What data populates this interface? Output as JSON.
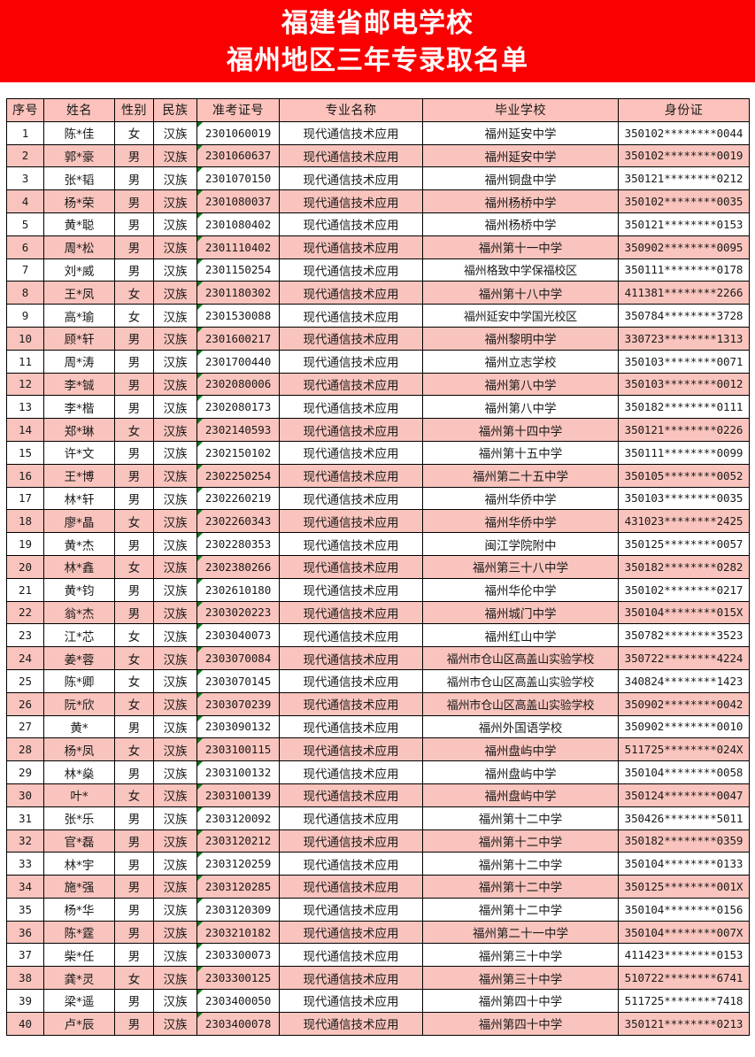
{
  "banner": {
    "line1": "福建省邮电学校",
    "line2": "福州地区三年专录取名单",
    "background_color": "#fb0000",
    "text_color": "#ffffff"
  },
  "colors": {
    "header_fill": "#fcc2bb",
    "row_alt_fill": "#f9c4bd",
    "row_fill": "#ffffff",
    "grid_line": "#000000",
    "text_flag_marker": "#0e7a18"
  },
  "table": {
    "headers": [
      "序号",
      "姓名",
      "性别",
      "民族",
      "准考证号",
      "专业名称",
      "毕业学校",
      "身份证"
    ],
    "rows": [
      {
        "seq": "1",
        "name": "陈*佳",
        "sex": "女",
        "eth": "汉族",
        "exam": "2301060019",
        "major": "现代通信技术应用",
        "school": "福州延安中学",
        "id": "350102********0044"
      },
      {
        "seq": "2",
        "name": "郭*豪",
        "sex": "男",
        "eth": "汉族",
        "exam": "2301060637",
        "major": "现代通信技术应用",
        "school": "福州延安中学",
        "id": "350102********0019"
      },
      {
        "seq": "3",
        "name": "张*韬",
        "sex": "男",
        "eth": "汉族",
        "exam": "2301070150",
        "major": "现代通信技术应用",
        "school": "福州铜盘中学",
        "id": "350121********0212"
      },
      {
        "seq": "4",
        "name": "杨*荣",
        "sex": "男",
        "eth": "汉族",
        "exam": "2301080037",
        "major": "现代通信技术应用",
        "school": "福州杨桥中学",
        "id": "350102********0035"
      },
      {
        "seq": "5",
        "name": "黄*聪",
        "sex": "男",
        "eth": "汉族",
        "exam": "2301080402",
        "major": "现代通信技术应用",
        "school": "福州杨桥中学",
        "id": "350121********0153"
      },
      {
        "seq": "6",
        "name": "周*松",
        "sex": "男",
        "eth": "汉族",
        "exam": "2301110402",
        "major": "现代通信技术应用",
        "school": "福州第十一中学",
        "id": "350902********0095"
      },
      {
        "seq": "7",
        "name": "刘*威",
        "sex": "男",
        "eth": "汉族",
        "exam": "2301150254",
        "major": "现代通信技术应用",
        "school": "福州格致中学保福校区",
        "id": "350111********0178"
      },
      {
        "seq": "8",
        "name": "王*凤",
        "sex": "女",
        "eth": "汉族",
        "exam": "2301180302",
        "major": "现代通信技术应用",
        "school": "福州第十八中学",
        "id": "411381********2266"
      },
      {
        "seq": "9",
        "name": "高*瑜",
        "sex": "女",
        "eth": "汉族",
        "exam": "2301530088",
        "major": "现代通信技术应用",
        "school": "福州延安中学国光校区",
        "id": "350784********3728"
      },
      {
        "seq": "10",
        "name": "顾*轩",
        "sex": "男",
        "eth": "汉族",
        "exam": "2301600217",
        "major": "现代通信技术应用",
        "school": "福州黎明中学",
        "id": "330723********1313"
      },
      {
        "seq": "11",
        "name": "周*涛",
        "sex": "男",
        "eth": "汉族",
        "exam": "2301700440",
        "major": "现代通信技术应用",
        "school": "福州立志学校",
        "id": "350103********0071"
      },
      {
        "seq": "12",
        "name": "李*铖",
        "sex": "男",
        "eth": "汉族",
        "exam": "2302080006",
        "major": "现代通信技术应用",
        "school": "福州第八中学",
        "id": "350103********0012"
      },
      {
        "seq": "13",
        "name": "李*楷",
        "sex": "男",
        "eth": "汉族",
        "exam": "2302080173",
        "major": "现代通信技术应用",
        "school": "福州第八中学",
        "id": "350182********0111"
      },
      {
        "seq": "14",
        "name": "郑*琳",
        "sex": "女",
        "eth": "汉族",
        "exam": "2302140593",
        "major": "现代通信技术应用",
        "school": "福州第十四中学",
        "id": "350121********0226"
      },
      {
        "seq": "15",
        "name": "许*文",
        "sex": "男",
        "eth": "汉族",
        "exam": "2302150102",
        "major": "现代通信技术应用",
        "school": "福州第十五中学",
        "id": "350111********0099"
      },
      {
        "seq": "16",
        "name": "王*博",
        "sex": "男",
        "eth": "汉族",
        "exam": "2302250254",
        "major": "现代通信技术应用",
        "school": "福州第二十五中学",
        "id": "350105********0052"
      },
      {
        "seq": "17",
        "name": "林*轩",
        "sex": "男",
        "eth": "汉族",
        "exam": "2302260219",
        "major": "现代通信技术应用",
        "school": "福州华侨中学",
        "id": "350103********0035"
      },
      {
        "seq": "18",
        "name": "廖*晶",
        "sex": "女",
        "eth": "汉族",
        "exam": "2302260343",
        "major": "现代通信技术应用",
        "school": "福州华侨中学",
        "id": "431023********2425"
      },
      {
        "seq": "19",
        "name": "黄*杰",
        "sex": "男",
        "eth": "汉族",
        "exam": "2302280353",
        "major": "现代通信技术应用",
        "school": "闽江学院附中",
        "id": "350125********0057"
      },
      {
        "seq": "20",
        "name": "林*鑫",
        "sex": "女",
        "eth": "汉族",
        "exam": "2302380266",
        "major": "现代通信技术应用",
        "school": "福州第三十八中学",
        "id": "350182********0282"
      },
      {
        "seq": "21",
        "name": "黄*钧",
        "sex": "男",
        "eth": "汉族",
        "exam": "2302610180",
        "major": "现代通信技术应用",
        "school": "福州华伦中学",
        "id": "350102********0217"
      },
      {
        "seq": "22",
        "name": "翁*杰",
        "sex": "男",
        "eth": "汉族",
        "exam": "2303020223",
        "major": "现代通信技术应用",
        "school": "福州城门中学",
        "id": "350104********015X"
      },
      {
        "seq": "23",
        "name": "江*芯",
        "sex": "女",
        "eth": "汉族",
        "exam": "2303040073",
        "major": "现代通信技术应用",
        "school": "福州红山中学",
        "id": "350782********3523"
      },
      {
        "seq": "24",
        "name": "姜*蓉",
        "sex": "女",
        "eth": "汉族",
        "exam": "2303070084",
        "major": "现代通信技术应用",
        "school": "福州市仓山区高盖山实验学校",
        "id": "350722********4224"
      },
      {
        "seq": "25",
        "name": "陈*卿",
        "sex": "女",
        "eth": "汉族",
        "exam": "2303070145",
        "major": "现代通信技术应用",
        "school": "福州市仓山区高盖山实验学校",
        "id": "340824********1423"
      },
      {
        "seq": "26",
        "name": "阮*欣",
        "sex": "女",
        "eth": "汉族",
        "exam": "2303070239",
        "major": "现代通信技术应用",
        "school": "福州市仓山区高盖山实验学校",
        "id": "350902********0042"
      },
      {
        "seq": "27",
        "name": "黄*",
        "sex": "男",
        "eth": "汉族",
        "exam": "2303090132",
        "major": "现代通信技术应用",
        "school": "福州外国语学校",
        "id": "350902********0010"
      },
      {
        "seq": "28",
        "name": "杨*凤",
        "sex": "女",
        "eth": "汉族",
        "exam": "2303100115",
        "major": "现代通信技术应用",
        "school": "福州盘屿中学",
        "id": "511725********024X"
      },
      {
        "seq": "29",
        "name": "林*燊",
        "sex": "男",
        "eth": "汉族",
        "exam": "2303100132",
        "major": "现代通信技术应用",
        "school": "福州盘屿中学",
        "id": "350104********0058"
      },
      {
        "seq": "30",
        "name": "叶*",
        "sex": "女",
        "eth": "汉族",
        "exam": "2303100139",
        "major": "现代通信技术应用",
        "school": "福州盘屿中学",
        "id": "350124********0047"
      },
      {
        "seq": "31",
        "name": "张*乐",
        "sex": "男",
        "eth": "汉族",
        "exam": "2303120092",
        "major": "现代通信技术应用",
        "school": "福州第十二中学",
        "id": "350426********5011"
      },
      {
        "seq": "32",
        "name": "官*磊",
        "sex": "男",
        "eth": "汉族",
        "exam": "2303120212",
        "major": "现代通信技术应用",
        "school": "福州第十二中学",
        "id": "350182********0359"
      },
      {
        "seq": "33",
        "name": "林*宇",
        "sex": "男",
        "eth": "汉族",
        "exam": "2303120259",
        "major": "现代通信技术应用",
        "school": "福州第十二中学",
        "id": "350104********0133"
      },
      {
        "seq": "34",
        "name": "施*强",
        "sex": "男",
        "eth": "汉族",
        "exam": "2303120285",
        "major": "现代通信技术应用",
        "school": "福州第十二中学",
        "id": "350125********001X"
      },
      {
        "seq": "35",
        "name": "杨*华",
        "sex": "男",
        "eth": "汉族",
        "exam": "2303120309",
        "major": "现代通信技术应用",
        "school": "福州第十二中学",
        "id": "350104********0156"
      },
      {
        "seq": "36",
        "name": "陈*霆",
        "sex": "男",
        "eth": "汉族",
        "exam": "2303210182",
        "major": "现代通信技术应用",
        "school": "福州第二十一中学",
        "id": "350104********007X"
      },
      {
        "seq": "37",
        "name": "柴*任",
        "sex": "男",
        "eth": "汉族",
        "exam": "2303300073",
        "major": "现代通信技术应用",
        "school": "福州第三十中学",
        "id": "411423********0153"
      },
      {
        "seq": "38",
        "name": "龚*灵",
        "sex": "女",
        "eth": "汉族",
        "exam": "2303300125",
        "major": "现代通信技术应用",
        "school": "福州第三十中学",
        "id": "510722********6741"
      },
      {
        "seq": "39",
        "name": "梁*遥",
        "sex": "男",
        "eth": "汉族",
        "exam": "2303400050",
        "major": "现代通信技术应用",
        "school": "福州第四十中学",
        "id": "511725********7418"
      },
      {
        "seq": "40",
        "name": "卢*辰",
        "sex": "男",
        "eth": "汉族",
        "exam": "2303400078",
        "major": "现代通信技术应用",
        "school": "福州第四十中学",
        "id": "350121********0213"
      }
    ]
  }
}
